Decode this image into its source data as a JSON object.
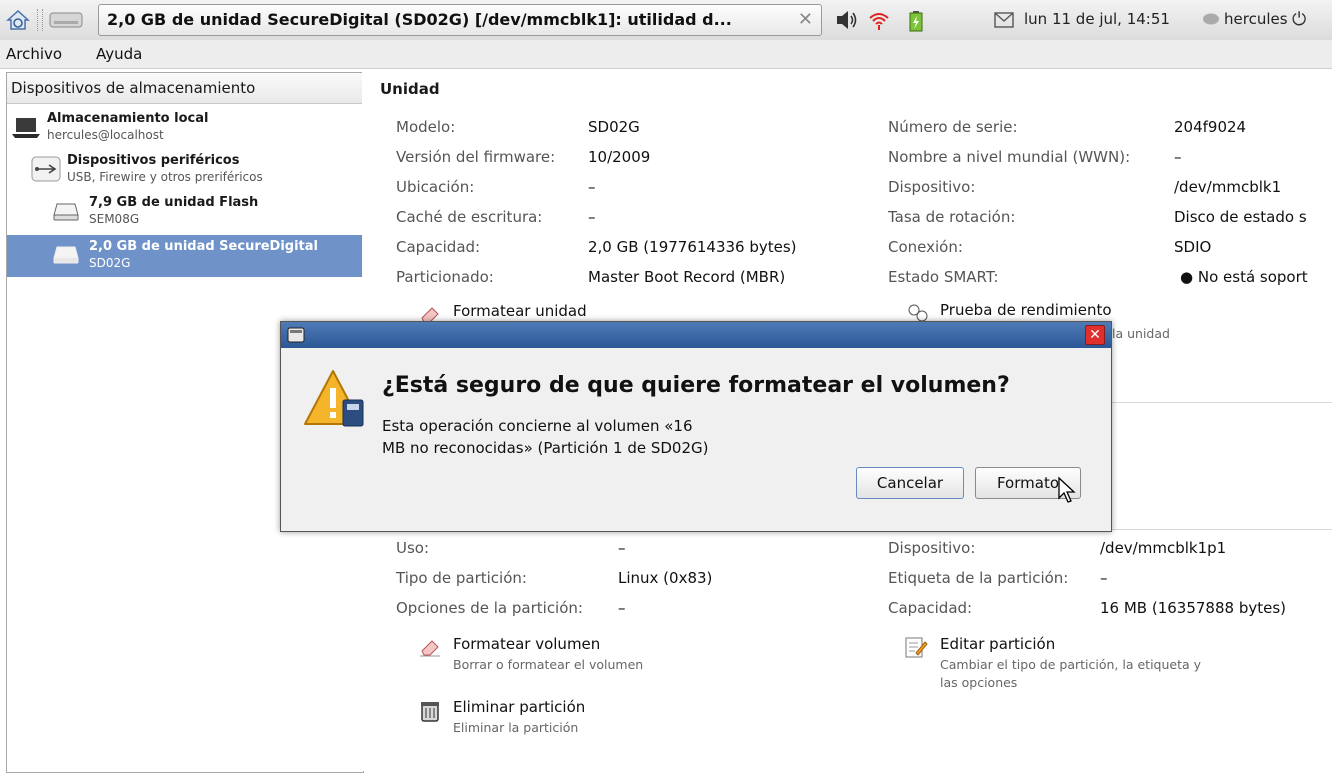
{
  "panel": {
    "task_title": "2,0 GB de unidad SecureDigital (SD02G) [/dev/mmcblk1]: utilidad d...",
    "task_close": "✕",
    "clock": "lun 11 de jul, 14:51",
    "user": "hercules"
  },
  "menubar": {
    "file": "Archivo",
    "help": "Ayuda"
  },
  "sidebar": {
    "header": "Dispositivos de almacenamiento",
    "items": [
      {
        "title": "Almacenamiento local",
        "subtitle": "hercules@localhost"
      },
      {
        "title": "Dispositivos periféricos",
        "subtitle": "USB, Firewire y otros preriféricos"
      },
      {
        "title": "7,9 GB de unidad Flash",
        "subtitle": "SEM08G"
      },
      {
        "title": "2,0 GB de unidad SecureDigital",
        "subtitle": "SD02G"
      }
    ]
  },
  "drive": {
    "section_title": "Unidad",
    "fields": {
      "model_label": "Modelo:",
      "model": "SD02G",
      "firmware_label": "Versión del firmware:",
      "firmware": "10/2009",
      "location_label": "Ubicación:",
      "location": "–",
      "cache_label": "Caché de escritura:",
      "cache": "–",
      "capacity_label": "Capacidad:",
      "capacity": "2,0 GB (1977614336 bytes)",
      "partitioning_label": "Particionado:",
      "partitioning": "Master Boot Record (MBR)",
      "serial_label": "Número de serie:",
      "serial": "204f9024",
      "wwn_label": "Nombre a nivel mundial (WWN):",
      "wwn": "–",
      "device_label": "Dispositivo:",
      "device": "/dev/mmcblk1",
      "rotation_label": "Tasa de rotación:",
      "rotation": "Disco de estado s",
      "connection_label": "Conexión:",
      "connection": "SDIO",
      "smart_label": "Estado SMART:",
      "smart": "● No está soport"
    },
    "actions": {
      "format_drive": "Formatear unidad",
      "benchmark": "Prueba de rendimiento",
      "benchmark_sub": "la unidad"
    }
  },
  "volume": {
    "fields": {
      "usage_label": "Uso:",
      "usage": "–",
      "ptype_label": "Tipo de partición:",
      "ptype": "Linux (0x83)",
      "popts_label": "Opciones de la partición:",
      "popts": "–",
      "device_label": "Dispositivo:",
      "device": "/dev/mmcblk1p1",
      "plabel_label": "Etiqueta de la partición:",
      "plabel": "–",
      "capacity_label": "Capacidad:",
      "capacity": "16 MB (16357888 bytes)"
    },
    "actions": {
      "format_volume": "Formatear volumen",
      "format_volume_sub": "Borrar o formatear el volumen",
      "edit_partition": "Editar partición",
      "edit_partition_sub1": "Cambiar el tipo de partición, la etiqueta y",
      "edit_partition_sub2": "las opciones",
      "delete_partition": "Eliminar partición",
      "delete_partition_sub": "Eliminar la partición"
    }
  },
  "dialog": {
    "heading": "¿Está seguro de que quiere formatear el volumen?",
    "body_line1": "Esta operación concierne al volumen «16",
    "body_line2": "MB no reconocidas» (Partición 1 de SD02G)",
    "cancel": "Cancelar",
    "confirm": "Formato"
  },
  "colors": {
    "selection": "#6f93c9",
    "titlebar": "#2b5796"
  }
}
